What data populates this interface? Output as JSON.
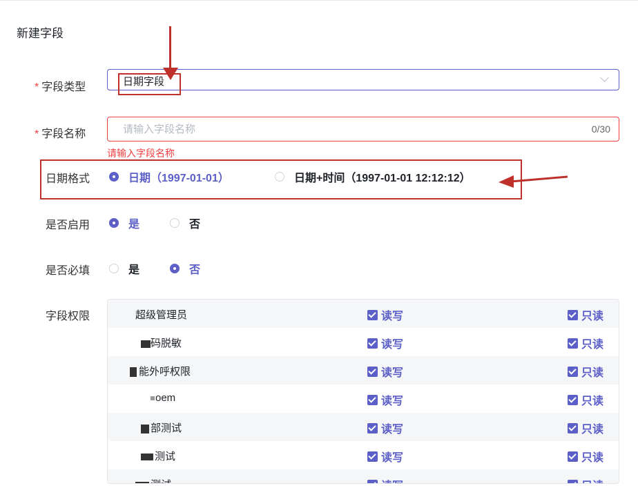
{
  "page": {
    "title": "新建字段"
  },
  "form": {
    "field_type": {
      "label": "字段类型",
      "required_mark": "*",
      "value": "日期字段"
    },
    "field_name": {
      "label": "字段名称",
      "required_mark": "*",
      "placeholder": "请输入字段名称",
      "value": "",
      "counter": "0/30",
      "error": "请输入字段名称"
    },
    "date_format": {
      "label": "日期格式",
      "options": [
        {
          "label": "日期（1997-01-01）",
          "selected": true
        },
        {
          "label": "日期+时间（1997-01-01 12:12:12）",
          "selected": false
        }
      ]
    },
    "enabled": {
      "label": "是否启用",
      "options": [
        {
          "label": "是",
          "selected": true
        },
        {
          "label": "否",
          "selected": false
        }
      ]
    },
    "required": {
      "label": "是否必填",
      "options": [
        {
          "label": "是",
          "selected": false
        },
        {
          "label": "否",
          "selected": true
        }
      ]
    },
    "permissions": {
      "label": "字段权限",
      "read_write_label": "读写",
      "read_only_label": "只读",
      "rows": [
        {
          "name": "超级管理员",
          "read_write": true,
          "read_only": true
        },
        {
          "name": "码脱敏",
          "read_write": true,
          "read_only": true
        },
        {
          "name": "能外呼权限",
          "read_write": true,
          "read_only": true
        },
        {
          "name": "oem",
          "read_write": true,
          "read_only": true
        },
        {
          "name": "部测试",
          "read_write": true,
          "read_only": true
        },
        {
          "name": "测试",
          "read_write": true,
          "read_only": true
        },
        {
          "name": "测试",
          "read_write": true,
          "read_only": true
        }
      ]
    }
  },
  "colors": {
    "accent": "#5b5fc7",
    "error": "#f53f3f",
    "annotation": "#c0302a"
  }
}
